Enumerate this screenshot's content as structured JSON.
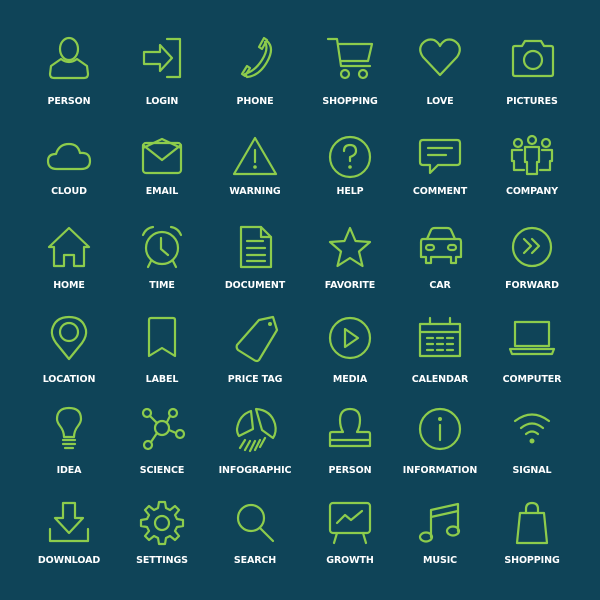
{
  "theme": {
    "background": "#0f4458",
    "icon_color": "#8dcc4c",
    "label_color": "#ffffff"
  },
  "icons": [
    {
      "label": "PERSON",
      "icon": "person-icon"
    },
    {
      "label": "LOGIN",
      "icon": "login-icon"
    },
    {
      "label": "PHONE",
      "icon": "phone-icon"
    },
    {
      "label": "SHOPPING",
      "icon": "shopping-cart-icon"
    },
    {
      "label": "LOVE",
      "icon": "heart-icon"
    },
    {
      "label": "PICTURES",
      "icon": "camera-icon"
    },
    {
      "label": "CLOUD",
      "icon": "cloud-icon"
    },
    {
      "label": "EMAIL",
      "icon": "envelope-icon"
    },
    {
      "label": "WARNING",
      "icon": "warning-triangle-icon"
    },
    {
      "label": "HELP",
      "icon": "question-circle-icon"
    },
    {
      "label": "COMMENT",
      "icon": "speech-bubble-icon"
    },
    {
      "label": "COMPANY",
      "icon": "group-icon"
    },
    {
      "label": "HOME",
      "icon": "house-icon"
    },
    {
      "label": "TIME",
      "icon": "alarm-clock-icon"
    },
    {
      "label": "DOCUMENT",
      "icon": "document-icon"
    },
    {
      "label": "FAVORITE",
      "icon": "star-icon"
    },
    {
      "label": "CAR",
      "icon": "car-icon"
    },
    {
      "label": "FORWARD",
      "icon": "forward-circle-icon"
    },
    {
      "label": "LOCATION",
      "icon": "map-pin-icon"
    },
    {
      "label": "LABEL",
      "icon": "bookmark-icon"
    },
    {
      "label": "PRICE TAG",
      "icon": "price-tag-icon"
    },
    {
      "label": "MEDIA",
      "icon": "play-circle-icon"
    },
    {
      "label": "CALENDAR",
      "icon": "calendar-icon"
    },
    {
      "label": "COMPUTER",
      "icon": "laptop-icon"
    },
    {
      "label": "IDEA",
      "icon": "lightbulb-icon"
    },
    {
      "label": "SCIENCE",
      "icon": "molecule-icon"
    },
    {
      "label": "INFOGRAPHIC",
      "icon": "pie-chart-icon"
    },
    {
      "label": "PERSON",
      "icon": "person-stamp-icon"
    },
    {
      "label": "INFORMATION",
      "icon": "info-circle-icon"
    },
    {
      "label": "SIGNAL",
      "icon": "wifi-icon"
    },
    {
      "label": "DOWNLOAD",
      "icon": "download-icon"
    },
    {
      "label": "SETTINGS",
      "icon": "gear-icon"
    },
    {
      "label": "SEARCH",
      "icon": "magnifier-icon"
    },
    {
      "label": "GROWTH",
      "icon": "presentation-chart-icon"
    },
    {
      "label": "MUSIC",
      "icon": "music-note-icon"
    },
    {
      "label": "SHOPPING",
      "icon": "shopping-bag-icon"
    }
  ]
}
